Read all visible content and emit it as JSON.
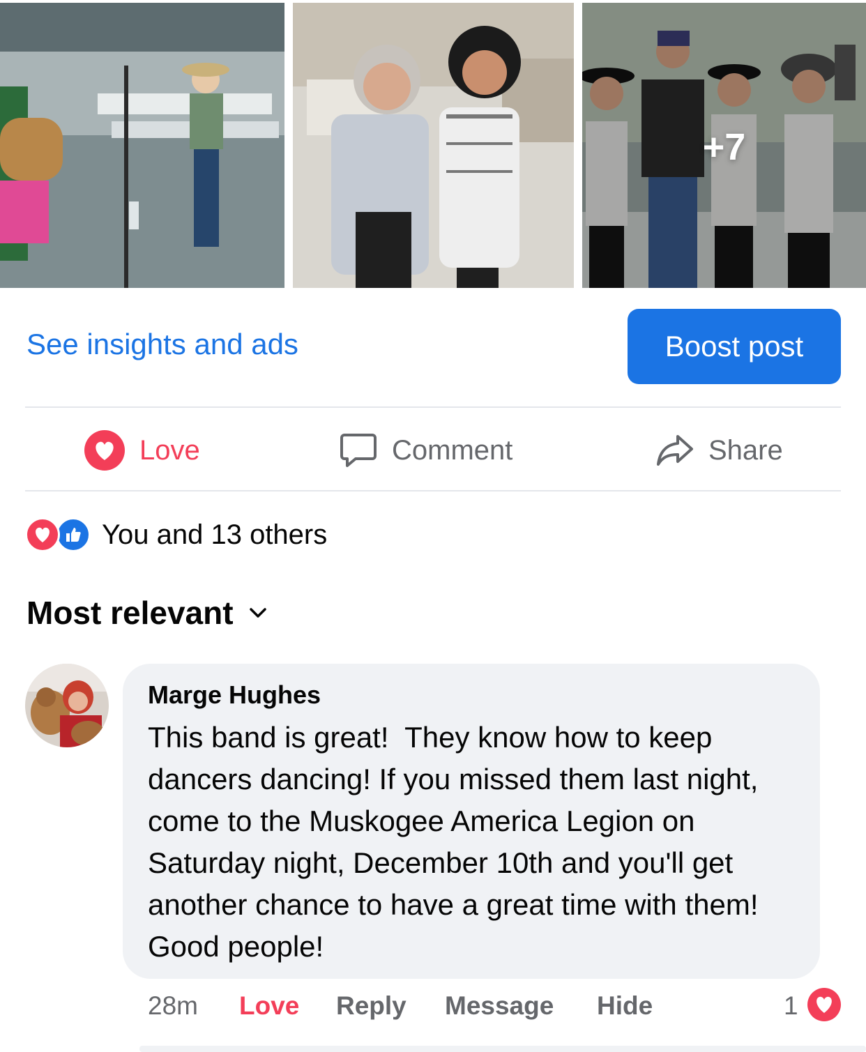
{
  "photos": {
    "more_count": "+7"
  },
  "post_actions": {
    "insights_label": "See insights and ads",
    "boost_label": "Boost post",
    "love_label": "Love",
    "comment_label": "Comment",
    "share_label": "Share"
  },
  "reactions": {
    "summary": "You and 13 others"
  },
  "comments": {
    "sort_label": "Most relevant",
    "items": [
      {
        "author": "Marge Hughes",
        "text": "This band is great!  They know how to keep dancers dancing! If you missed them last night, come to the Muskogee America Legion on Saturday night, December 10th and you'll get another chance to have a great time with them!  Good people!",
        "time": "28m",
        "love_label": "Love",
        "reply_label": "Reply",
        "message_label": "Message",
        "hide_label": "Hide",
        "reaction_count": "1"
      }
    ]
  },
  "colors": {
    "accent": "#1b74e4",
    "love": "#f33e58",
    "secondary_text": "#65676b",
    "bubble": "#f0f2f5"
  }
}
